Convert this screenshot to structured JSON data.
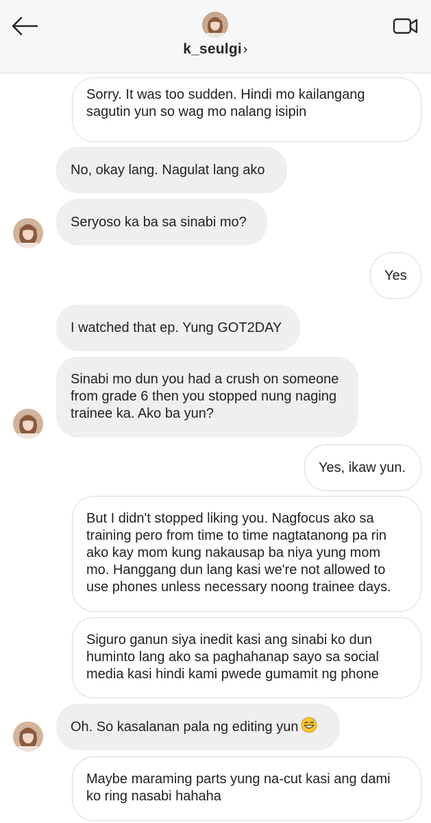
{
  "header": {
    "username": "k_seulgi",
    "chevron": "›",
    "back_icon": "arrow-left-icon",
    "video_icon": "video-call-icon"
  },
  "colors": {
    "incoming_bubble": "#efefef",
    "outgoing_border": "#dbdbdb",
    "header_bg": "#f7f7f7"
  },
  "messages": [
    {
      "side": "out",
      "text": "Sorry. It was too sudden. Hindi mo kailangang sagutin yun so wag mo nalang isipin"
    },
    {
      "side": "in",
      "text": "No, okay lang. Nagulat lang ako"
    },
    {
      "side": "in",
      "text": "Seryoso ka ba sa sinabi mo?"
    },
    {
      "side": "out",
      "text": "Yes"
    },
    {
      "side": "in",
      "text": "I watched that ep. Yung GOT2DAY"
    },
    {
      "side": "in",
      "text": "Sinabi mo dun you had a crush on someone from grade 6 then you stopped nung naging trainee ka. Ako ba yun?"
    },
    {
      "side": "out",
      "text": "Yes, ikaw yun."
    },
    {
      "side": "out",
      "text": "But I didn't stopped liking you. Nagfocus ako sa training pero from time to time nagtatanong pa rin ako kay mom kung nakausap ba niya yung mom mo. Hanggang dun lang kasi we're not allowed to use phones unless necessary noong trainee days."
    },
    {
      "side": "out",
      "text": "Siguro ganun siya inedit kasi ang sinabi ko dun huminto lang ako sa paghahanap sayo sa social media kasi hindi kami pwede gumamit ng phone"
    },
    {
      "side": "in",
      "text": "Oh. So kasalanan pala ng editing yun",
      "emoji": "grinning-sweat-emoji"
    },
    {
      "side": "out",
      "text": "Maybe maraming parts yung na-cut kasi ang dami ko ring nasabi hahaha"
    }
  ]
}
